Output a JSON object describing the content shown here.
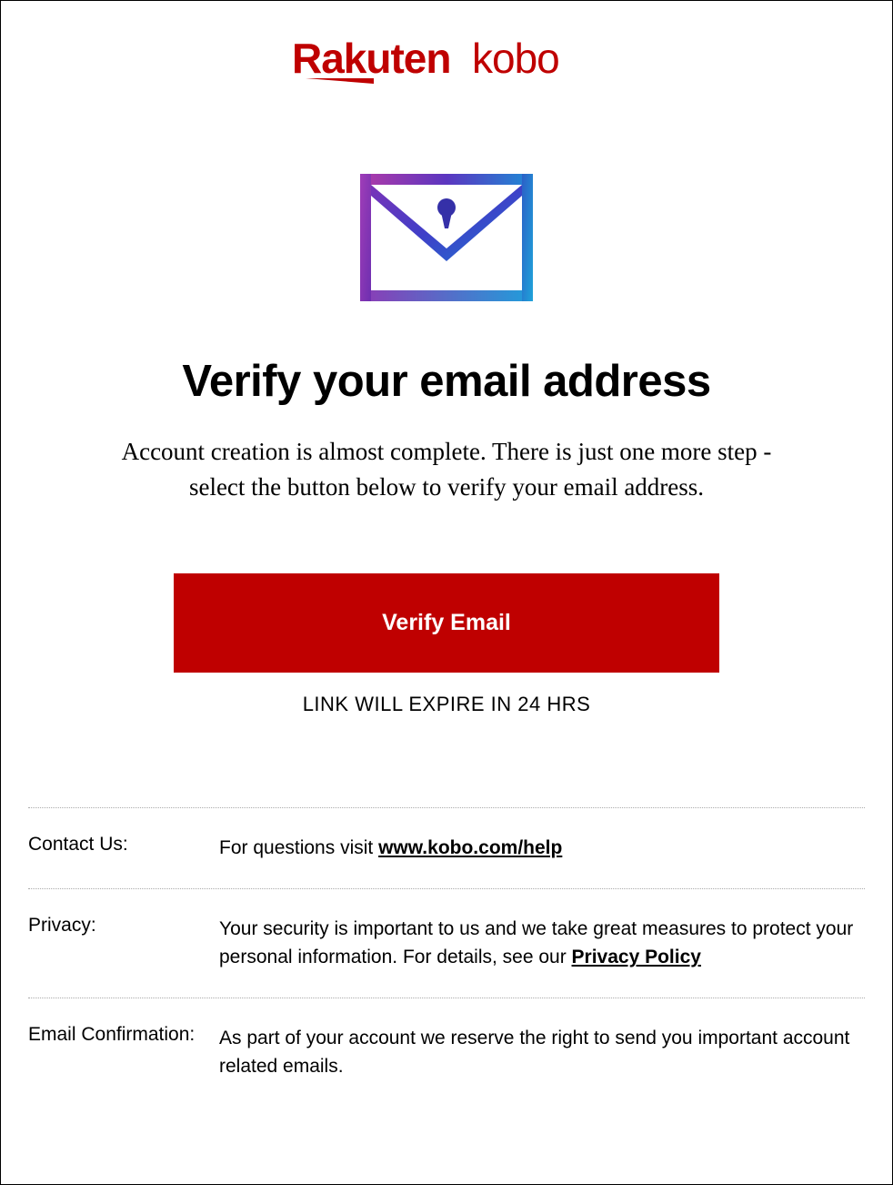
{
  "brand": {
    "name": "Rakuten kobo",
    "color": "#bf0000"
  },
  "icon": {
    "name": "envelope-lock-icon"
  },
  "main": {
    "title": "Verify your email address",
    "subtitle": "Account creation is almost complete. There is just one more step - select the button below to verify your email address.",
    "button_label": "Verify Email",
    "expire_text": "LINK WILL EXPIRE IN 24 HRS"
  },
  "footer": {
    "rows": [
      {
        "label": "Contact Us:",
        "text_before": "For questions visit ",
        "link_text": "www.kobo.com/help",
        "text_after": ""
      },
      {
        "label": "Privacy:",
        "text_before": "Your security is important to us and we take great measures to protect your personal information. For details, see our ",
        "link_text": "Privacy Policy",
        "text_after": ""
      },
      {
        "label": "Email Confirmation:",
        "text_before": "As part of your account we reserve the right to send you important account related emails.",
        "link_text": "",
        "text_after": ""
      }
    ]
  }
}
